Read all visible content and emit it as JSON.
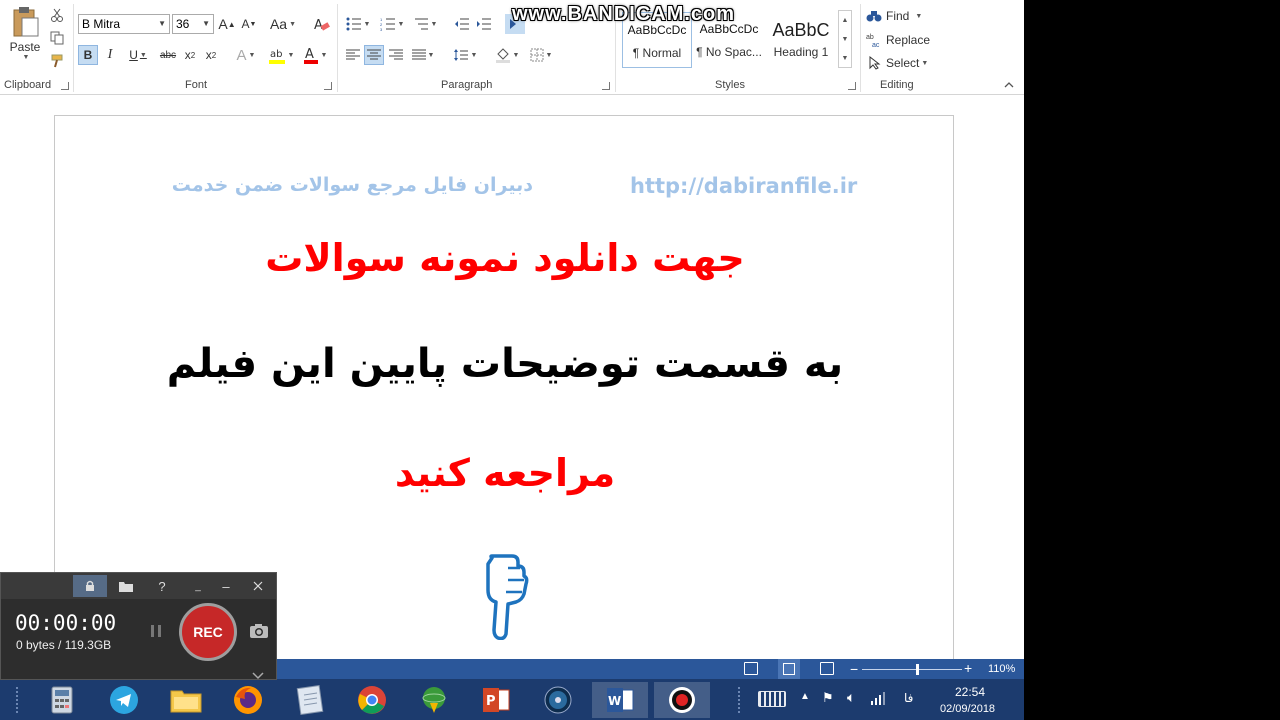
{
  "watermark": "www.BANDICAM.com",
  "ribbon": {
    "clipboard": {
      "paste_label": "Paste",
      "group_label": "Clipboard"
    },
    "font": {
      "font_name": "B Mitra",
      "font_size": "36",
      "group_label": "Font",
      "change_case": "Aa"
    },
    "paragraph": {
      "group_label": "Paragraph"
    },
    "styles": {
      "group_label": "Styles",
      "items": [
        {
          "sample": "AaBbCcDc",
          "name": "¶ Normal"
        },
        {
          "sample": "AaBbCcDc",
          "name": "¶ No Spac..."
        },
        {
          "sample": "AaBbC",
          "name": "Heading 1"
        }
      ]
    },
    "editing": {
      "group_label": "Editing",
      "find": "Find",
      "replace": "Replace",
      "select": "Select"
    }
  },
  "document": {
    "header_right_url": "http://dabiranfile.ir",
    "header_left_text": "دبیران فایل مرجع سوالات ضمن خدمت",
    "line1": "جهت دانلود نمونه سوالات",
    "line2": "به قسمت توضیحات پایین این فیلم",
    "line3": "مراجعه کنید",
    "colors": {
      "link": "#a3c4e8",
      "red": "#ff0000",
      "black": "#000000",
      "hand": "#1e73be"
    }
  },
  "statusbar": {
    "zoom": "110%",
    "zoom_level": 0.55
  },
  "taskbar": {
    "time": "22:54",
    "date": "02/09/2018",
    "lang": "فا"
  },
  "bandicam": {
    "timer": "00:00:00",
    "size": "0 bytes / 119.3GB",
    "rec_label": "REC",
    "help": "?"
  }
}
